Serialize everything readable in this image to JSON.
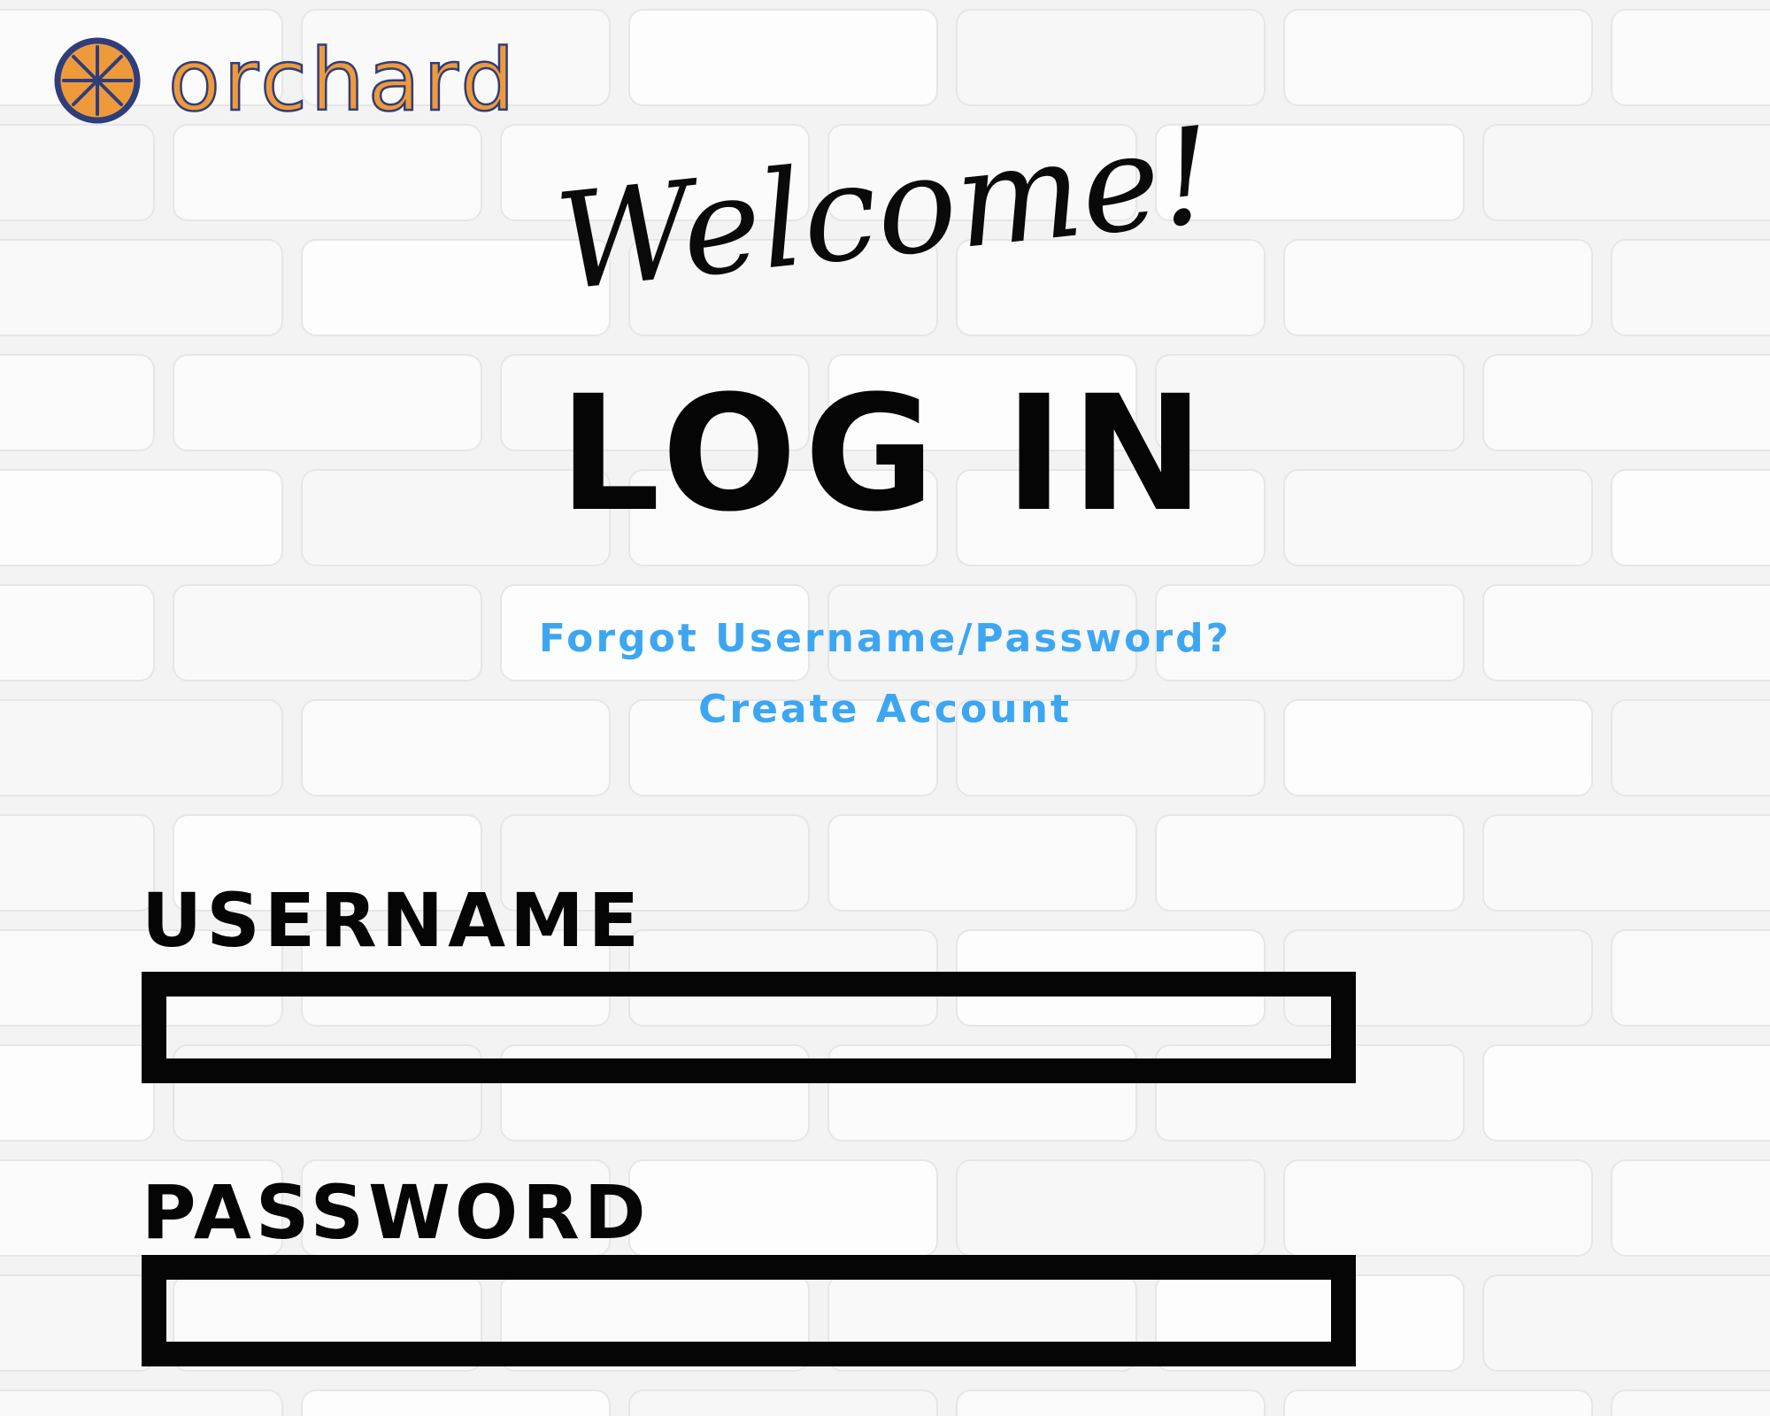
{
  "brand": {
    "name": "orchard",
    "logo_icon": "orange-slice-icon",
    "colors": {
      "orange": "#ee9a3b",
      "navy": "#2f3d7a"
    }
  },
  "welcome_text": "Welcome!",
  "login_title": "LOG IN",
  "links": {
    "forgot": "Forgot Username/Password?",
    "create_account": "Create Account",
    "color": "#3da6f2"
  },
  "form": {
    "username_label": "USERNAME",
    "username_value": "",
    "password_label": "PASSWORD",
    "password_value": ""
  },
  "background": "white-brick-wall"
}
